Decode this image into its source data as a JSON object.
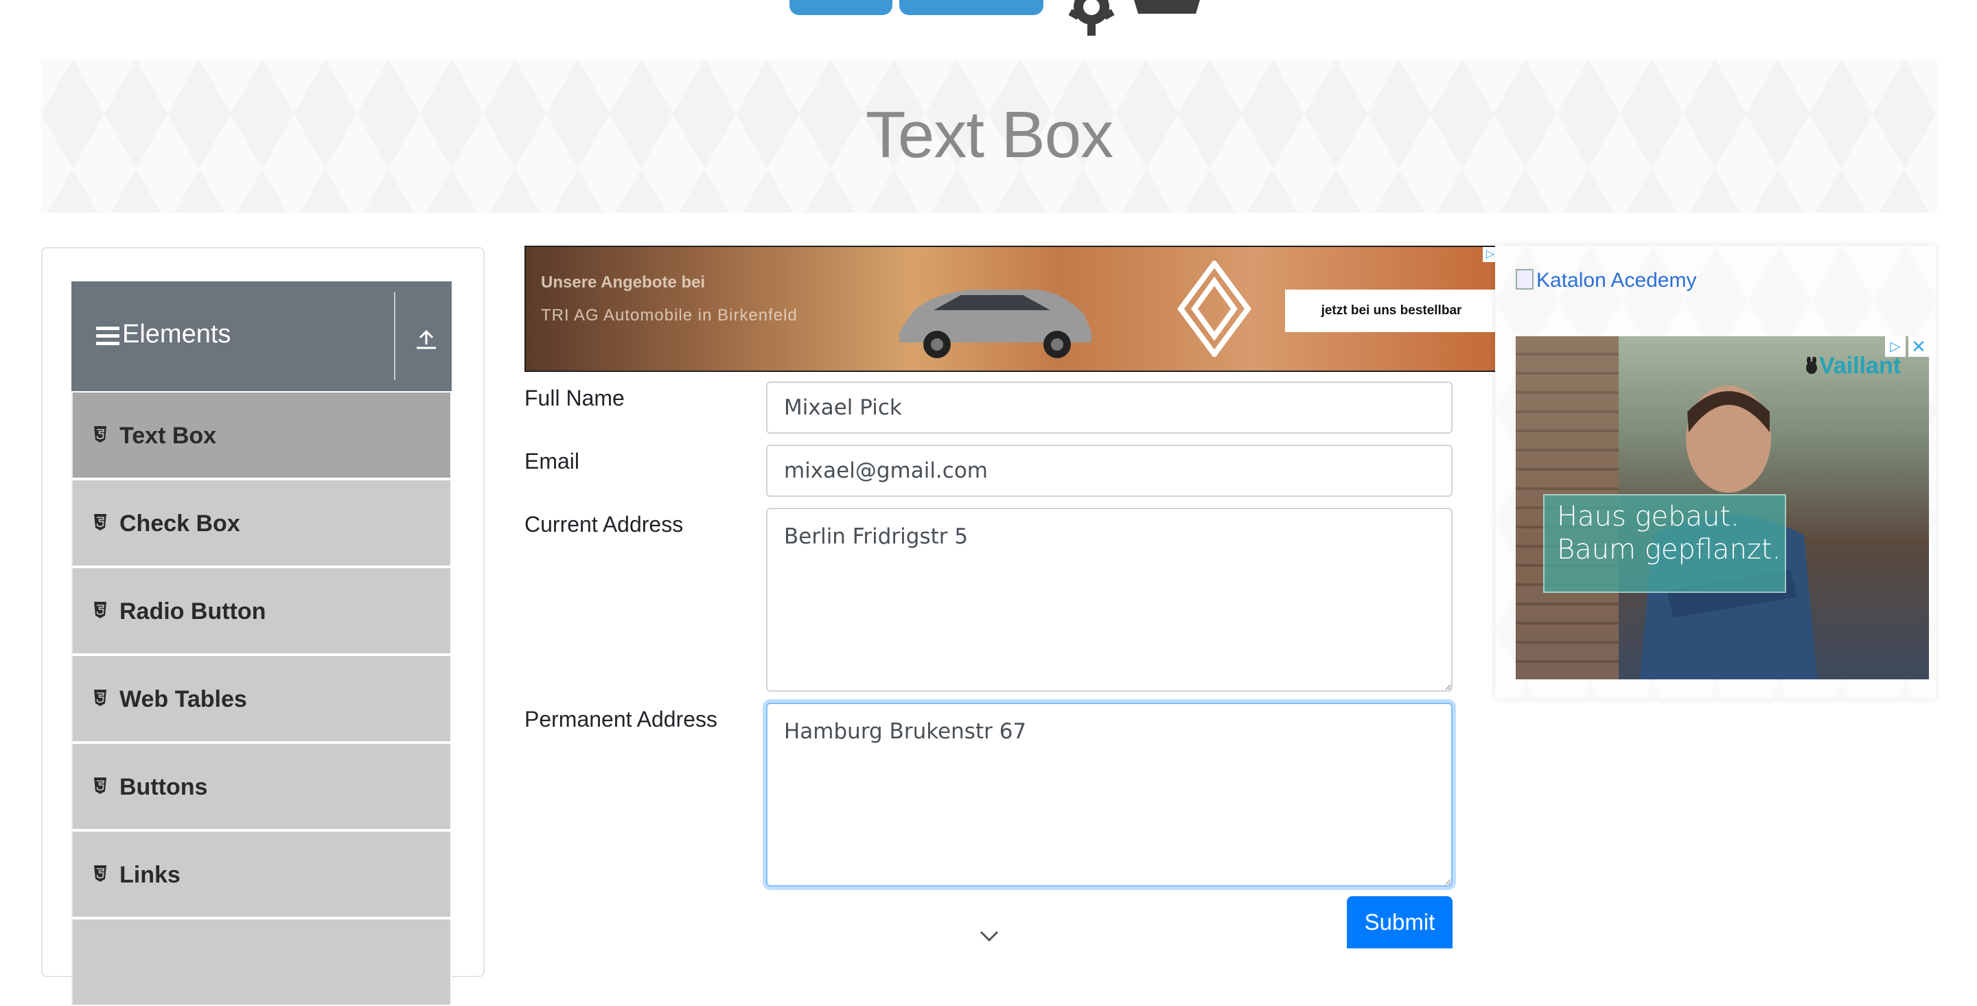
{
  "header": {
    "page_title": "Text Box"
  },
  "sidebar": {
    "group_title": "Elements",
    "items": [
      {
        "label": "Text Box",
        "active": true
      },
      {
        "label": "Check Box",
        "active": false
      },
      {
        "label": "Radio Button",
        "active": false
      },
      {
        "label": "Web Tables",
        "active": false
      },
      {
        "label": "Buttons",
        "active": false
      },
      {
        "label": "Links",
        "active": false
      }
    ]
  },
  "ad_top": {
    "line1": "Unsere Angebote bei",
    "line2": "TRI AG Automobile in Birkenfeld",
    "cta": "jetzt bei uns bestellbar",
    "adchoices_icon": "▷"
  },
  "form": {
    "full_name": {
      "label": "Full Name",
      "value": "Mixael Pick"
    },
    "email": {
      "label": "Email",
      "value": "mixael@gmail.com"
    },
    "current_address": {
      "label": "Current Address",
      "value": "Berlin Fridrigstr 5"
    },
    "permanent_address": {
      "label": "Permanent Address",
      "value": "Hamburg Brukenstr 67"
    },
    "submit_label": "Submit"
  },
  "ad_right": {
    "link_text": "Katalon Acedemy",
    "brand": "Vaillant",
    "tagline_1": "Haus gebaut.",
    "tagline_2": "Baum gepflanzt.",
    "close_icon": "✕",
    "adchoices_icon": "▷"
  },
  "colors": {
    "accent": "#007bff",
    "sidebar_header": "#6c757d",
    "sidebar_item": "#cbcbcb",
    "sidebar_item_active": "#a7a7a7",
    "title_gray": "#8a8a8a"
  }
}
